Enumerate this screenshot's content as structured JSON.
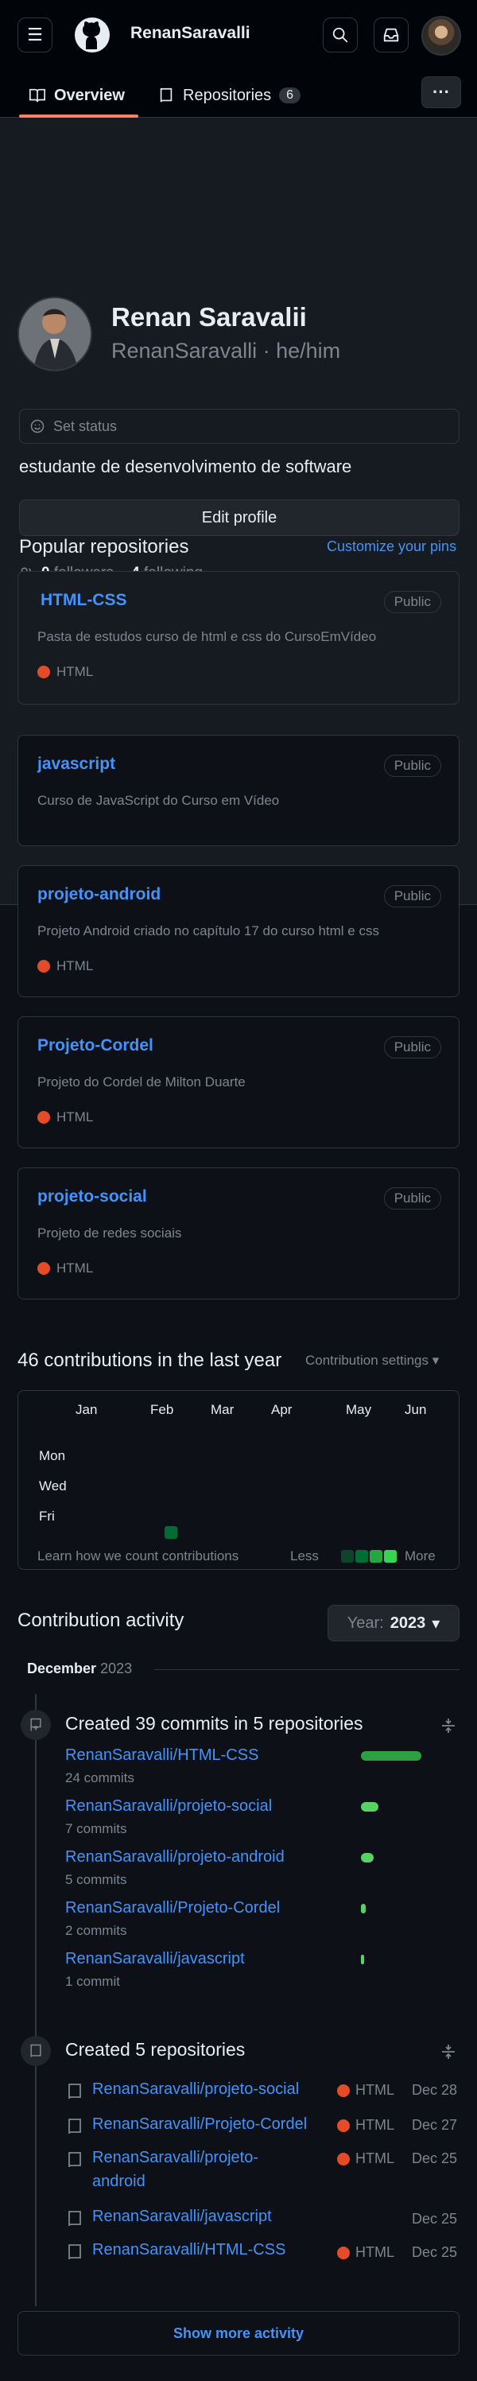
{
  "header": {
    "brand": "RenanSaravalli",
    "tabs": [
      {
        "label": "Overview"
      },
      {
        "label": "Repositories",
        "count": "6"
      }
    ],
    "more": "···"
  },
  "profile": {
    "name": "Renan Saravalii",
    "login_line": "RenanSaravalli · he/him",
    "status": "Set status",
    "bio": "estudante de desenvolvimento de software",
    "edit": "Edit profile",
    "followers": "0",
    "followers_label": "followers",
    "separator": "·",
    "following": "4",
    "following_label": "following"
  },
  "popular": {
    "title": "Popular repositories",
    "customize": "Customize your pins",
    "items": [
      {
        "name": "HTML-CSS",
        "visibility": "Public",
        "description": "Pasta de estudos curso de html e css do CursoEmVídeo",
        "language": "HTML"
      },
      {
        "name": "javascript",
        "visibility": "Public",
        "description": "Curso de JavaScript do Curso em Vídeo",
        "language": ""
      },
      {
        "name": "projeto-android",
        "visibility": "Public",
        "description": "Projeto Android criado no capítulo 17 do curso html e css",
        "language": "HTML"
      },
      {
        "name": "Projeto-Cordel",
        "visibility": "Public",
        "description": "Projeto do Cordel de Milton Duarte",
        "language": "HTML"
      },
      {
        "name": "projeto-social",
        "visibility": "Public",
        "description": "Projeto de redes sociais",
        "language": "HTML"
      }
    ]
  },
  "contributions": {
    "title": "46 contributions in the last year",
    "settings": "Contribution settings ▾",
    "months": [
      "Jan",
      "Feb",
      "Mar",
      "Apr",
      "May",
      "Jun"
    ],
    "days": [
      "Mon",
      "Wed",
      "Fri"
    ],
    "learn": "Learn how we count contributions",
    "less": "Less",
    "more": "More"
  },
  "activity": {
    "title": "Contribution activity",
    "year_prefix": "Year:",
    "year": "2023",
    "month": "December",
    "month_year": "2023",
    "commits_title": "Created 39 commits in 5 repositories",
    "commit_repos": [
      {
        "name": "RenanSaravalli/HTML-CSS",
        "count": "24 commits",
        "share": 1.0
      },
      {
        "name": "RenanSaravalli/projeto-social",
        "count": "7 commits",
        "share": 0.29
      },
      {
        "name": "RenanSaravalli/projeto-android",
        "count": "5 commits",
        "share": 0.21
      },
      {
        "name": "RenanSaravalli/Projeto-Cordel",
        "count": "2 commits",
        "share": 0.08
      },
      {
        "name": "RenanSaravalli/javascript",
        "count": "1 commit",
        "share": 0.04
      }
    ],
    "created_title": "Created 5 repositories",
    "created_repos": [
      {
        "name": "RenanSaravalli/projeto-social",
        "language": "HTML",
        "date": "Dec 28"
      },
      {
        "name": "RenanSaravalli/Projeto-Cordel",
        "language": "HTML",
        "date": "Dec 27"
      },
      {
        "name": "RenanSaravalli/projeto-android",
        "language": "HTML",
        "date": "Dec 25"
      },
      {
        "name": "RenanSaravalli/javascript",
        "language": "",
        "date": "Dec 25"
      },
      {
        "name": "RenanSaravalli/HTML-CSS",
        "language": "HTML",
        "date": "Dec 25"
      }
    ],
    "show_more": "Show more activity"
  },
  "colors": {
    "accent": "#4493f8",
    "tab_underline": "#f78166",
    "html_lang": "#e34c26",
    "graph_low": "#0e4429",
    "graph_high": "#39d353"
  }
}
